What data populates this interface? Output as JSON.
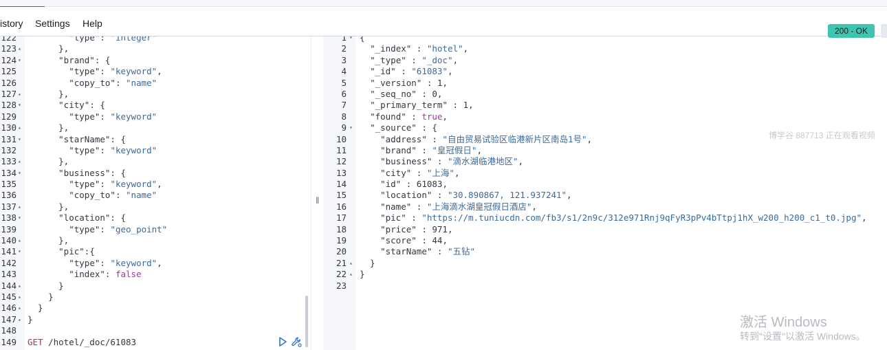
{
  "menu": {
    "history": "istory",
    "settings": "Settings",
    "help": "Help"
  },
  "response_status": "200 - OK",
  "request": {
    "lines": [
      {
        "n": "122",
        "fold": "",
        "code": "        \"type\": \"integer\""
      },
      {
        "n": "123",
        "fold": "▴",
        "code": "      },"
      },
      {
        "n": "124",
        "fold": "▾",
        "code": "      \"brand\": {"
      },
      {
        "n": "125",
        "fold": "",
        "code": "        \"type\": \"keyword\","
      },
      {
        "n": "126",
        "fold": "",
        "code": "        \"copy_to\": \"name\""
      },
      {
        "n": "127",
        "fold": "▴",
        "code": "      },"
      },
      {
        "n": "128",
        "fold": "▾",
        "code": "      \"city\": {"
      },
      {
        "n": "129",
        "fold": "",
        "code": "        \"type\": \"keyword\""
      },
      {
        "n": "130",
        "fold": "▴",
        "code": "      },"
      },
      {
        "n": "131",
        "fold": "▾",
        "code": "      \"starName\": {"
      },
      {
        "n": "132",
        "fold": "",
        "code": "        \"type\": \"keyword\""
      },
      {
        "n": "133",
        "fold": "▴",
        "code": "      },"
      },
      {
        "n": "134",
        "fold": "▾",
        "code": "      \"business\": {"
      },
      {
        "n": "135",
        "fold": "",
        "code": "        \"type\": \"keyword\","
      },
      {
        "n": "136",
        "fold": "",
        "code": "        \"copy_to\": \"name\""
      },
      {
        "n": "137",
        "fold": "▴",
        "code": "      },"
      },
      {
        "n": "138",
        "fold": "▾",
        "code": "      \"location\": {"
      },
      {
        "n": "139",
        "fold": "",
        "code": "        \"type\": \"geo_point\""
      },
      {
        "n": "140",
        "fold": "▴",
        "code": "      },"
      },
      {
        "n": "141",
        "fold": "▾",
        "code": "      \"pic\":{"
      },
      {
        "n": "142",
        "fold": "",
        "code": "        \"type\": \"keyword\","
      },
      {
        "n": "143",
        "fold": "",
        "code": "        \"index\": false"
      },
      {
        "n": "144",
        "fold": "▴",
        "code": "      }"
      },
      {
        "n": "145",
        "fold": "▴",
        "code": "    }"
      },
      {
        "n": "146",
        "fold": "▴",
        "code": "  }"
      },
      {
        "n": "147",
        "fold": "▴",
        "code": "}"
      },
      {
        "n": "148",
        "fold": "",
        "code": ""
      },
      {
        "n": "149",
        "fold": "",
        "code": "GET /hotel/_doc/61083"
      }
    ]
  },
  "response": {
    "lines": [
      {
        "n": "1",
        "fold": "▾",
        "code": "{"
      },
      {
        "n": "2",
        "fold": "",
        "code": "  \"_index\" : \"hotel\","
      },
      {
        "n": "3",
        "fold": "",
        "code": "  \"_type\" : \"_doc\","
      },
      {
        "n": "4",
        "fold": "",
        "code": "  \"_id\" : \"61083\","
      },
      {
        "n": "5",
        "fold": "",
        "code": "  \"_version\" : 1,"
      },
      {
        "n": "6",
        "fold": "",
        "code": "  \"_seq_no\" : 0,"
      },
      {
        "n": "7",
        "fold": "",
        "code": "  \"_primary_term\" : 1,"
      },
      {
        "n": "8",
        "fold": "",
        "code": "  \"found\" : true,"
      },
      {
        "n": "9",
        "fold": "▾",
        "code": "  \"_source\" : {"
      },
      {
        "n": "10",
        "fold": "",
        "code": "    \"address\" : \"自由贸易试验区临港新片区南岛1号\","
      },
      {
        "n": "11",
        "fold": "",
        "code": "    \"brand\" : \"皇冠假日\","
      },
      {
        "n": "12",
        "fold": "",
        "code": "    \"business\" : \"滴水湖临港地区\","
      },
      {
        "n": "13",
        "fold": "",
        "code": "    \"city\" : \"上海\","
      },
      {
        "n": "14",
        "fold": "",
        "code": "    \"id\" : 61083,"
      },
      {
        "n": "15",
        "fold": "",
        "code": "    \"location\" : \"30.890867, 121.937241\","
      },
      {
        "n": "16",
        "fold": "",
        "code": "    \"name\" : \"上海滴水湖皇冠假日酒店\","
      },
      {
        "n": "17",
        "fold": "",
        "code": "    \"pic\" : \"https://m.tuniucdn.com/fb3/s1/2n9c/312e971Rnj9qFyR3pPv4bTtpj1hX_w200_h200_c1_t0.jpg\","
      },
      {
        "n": "18",
        "fold": "",
        "code": "    \"price\" : 971,"
      },
      {
        "n": "19",
        "fold": "",
        "code": "    \"score\" : 44,"
      },
      {
        "n": "20",
        "fold": "",
        "code": "    \"starName\" : \"五钻\""
      },
      {
        "n": "21",
        "fold": "▴",
        "code": "  }"
      },
      {
        "n": "22",
        "fold": "▴",
        "code": "}"
      },
      {
        "n": "23",
        "fold": "",
        "code": ""
      }
    ]
  },
  "watermark": "博学谷 887713 正在观看视频",
  "activate_windows": {
    "title": "激活 Windows",
    "subtitle": "转到\"设置\"以激活 Windows。"
  }
}
